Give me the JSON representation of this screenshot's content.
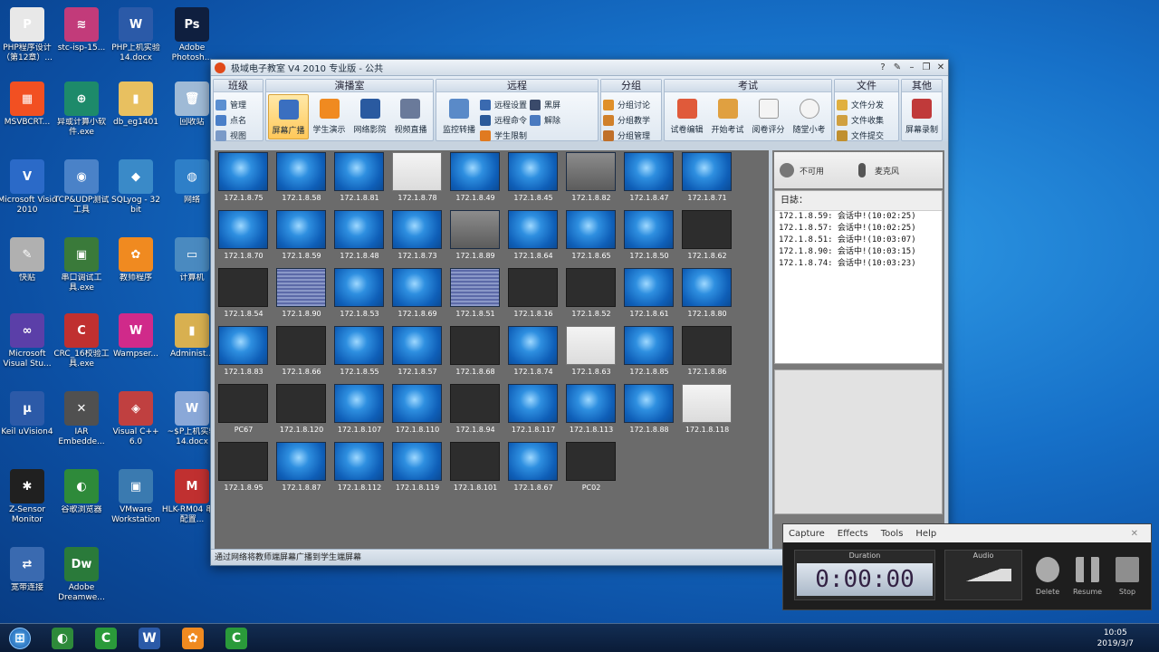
{
  "desktop_icons": [
    {
      "label": "PHP程序设计（第12章）...",
      "color": "#e8e8e8",
      "glyph": "P"
    },
    {
      "label": "stc-isp-15...",
      "color": "#c23b7a",
      "glyph": "≋"
    },
    {
      "label": "PHP上机实验14.docx",
      "color": "#2b5aa8",
      "glyph": "W"
    },
    {
      "label": "Adobe Photosh...",
      "color": "#0f1f3f",
      "glyph": "Ps"
    },
    {
      "label": "MSVBCRT...",
      "color": "#f25022",
      "glyph": "▦"
    },
    {
      "label": "异或计算小软件.exe",
      "color": "#1d8a6a",
      "glyph": "⊕"
    },
    {
      "label": "db_eg1401",
      "color": "#e8c060",
      "glyph": "▮"
    },
    {
      "label": "回收站",
      "color": "#9fbad6",
      "glyph": "🗑"
    },
    {
      "label": "Microsoft Visio 2010",
      "color": "#2b6ac8",
      "glyph": "V"
    },
    {
      "label": "TCP&UDP测试工具",
      "color": "#4a82c8",
      "glyph": "◉"
    },
    {
      "label": "SQLyog - 32 bit",
      "color": "#3a8ac8",
      "glyph": "◆"
    },
    {
      "label": "网络",
      "color": "#2e7fc8",
      "glyph": "◍"
    },
    {
      "label": "快贴",
      "color": "#b0b0b0",
      "glyph": "✎"
    },
    {
      "label": "串口调试工具.exe",
      "color": "#3a7a3a",
      "glyph": "▣"
    },
    {
      "label": "教师程序",
      "color": "#f08a20",
      "glyph": "✿"
    },
    {
      "label": "计算机",
      "color": "#4a8ac0",
      "glyph": "▭"
    },
    {
      "label": "Microsoft Visual Stu...",
      "color": "#5b3fa8",
      "glyph": "∞"
    },
    {
      "label": "CRC_16校验工具.exe",
      "color": "#c03030",
      "glyph": "C"
    },
    {
      "label": "Wampser...",
      "color": "#d02a8a",
      "glyph": "W"
    },
    {
      "label": "Administ...",
      "color": "#d8b050",
      "glyph": "▮"
    },
    {
      "label": "Keil uVision4",
      "color": "#2c5aa8",
      "glyph": "µ"
    },
    {
      "label": "IAR Embedde...",
      "color": "#505050",
      "glyph": "✕"
    },
    {
      "label": "Visual C++ 6.0",
      "color": "#c04040",
      "glyph": "◈"
    },
    {
      "label": "~$P上机实验14.docx",
      "color": "#8aa8d8",
      "glyph": "W"
    },
    {
      "label": "Z-Sensor Monitor",
      "color": "#202020",
      "glyph": "✱"
    },
    {
      "label": "谷歌浏览器",
      "color": "#2e8a3a",
      "glyph": "◐"
    },
    {
      "label": "VMware Workstation",
      "color": "#3a7ab0",
      "glyph": "▣"
    },
    {
      "label": "HLK-RM04 串口配置...",
      "color": "#c03030",
      "glyph": "M"
    },
    {
      "label": "宽带连接",
      "color": "#3a6ab0",
      "glyph": "⇄"
    },
    {
      "label": "Adobe Dreamwe...",
      "color": "#2a7a3a",
      "glyph": "Dw"
    }
  ],
  "window": {
    "title": "极域电子教室 V4 2010 专业版 - 公共",
    "title_buttons": [
      "?",
      "✎",
      "–",
      "❐",
      "✕"
    ]
  },
  "ribbon": {
    "groups": [
      {
        "name": "班级",
        "small": [
          "管理",
          "点名",
          "视图"
        ]
      },
      {
        "name": "演播室",
        "big": [
          "屏幕广播",
          "学生演示",
          "网络影院",
          "视频直播"
        ]
      },
      {
        "name": "远程",
        "big": [
          "监控转播"
        ],
        "small": [
          "远程设置",
          "远程命令",
          "学生限制"
        ],
        "small2": [
          "黑屏",
          "解除"
        ]
      },
      {
        "name": "分组",
        "small": [
          "分组讨论",
          "分组教学",
          "分组管理"
        ]
      },
      {
        "name": "考试",
        "big": [
          "试卷编辑",
          "开始考试",
          "阅卷评分",
          "随堂小考"
        ]
      },
      {
        "name": "文件",
        "small": [
          "文件分发",
          "文件收集",
          "文件提交"
        ]
      },
      {
        "name": "其他",
        "big": [
          "屏幕录制"
        ]
      }
    ]
  },
  "students": [
    {
      "label": "172.1.8.75",
      "state": "on"
    },
    {
      "label": "172.1.8.58",
      "state": "on"
    },
    {
      "label": "172.1.8.81",
      "state": "on"
    },
    {
      "label": "172.1.8.78",
      "state": "white"
    },
    {
      "label": "172.1.8.49",
      "state": "on"
    },
    {
      "label": "172.1.8.45",
      "state": "on"
    },
    {
      "label": "172.1.8.82",
      "state": "dim"
    },
    {
      "label": "172.1.8.47",
      "state": "on"
    },
    {
      "label": "172.1.8.71",
      "state": "on"
    },
    {
      "label": "172.1.8.70",
      "state": "on"
    },
    {
      "label": "172.1.8.59",
      "state": "on"
    },
    {
      "label": "172.1.8.48",
      "state": "on"
    },
    {
      "label": "172.1.8.73",
      "state": "on"
    },
    {
      "label": "172.1.8.89",
      "state": "dim"
    },
    {
      "label": "172.1.8.64",
      "state": "on"
    },
    {
      "label": "172.1.8.65",
      "state": "on"
    },
    {
      "label": "172.1.8.50",
      "state": "on"
    },
    {
      "label": "172.1.8.62",
      "state": "off"
    },
    {
      "label": "172.1.8.54",
      "state": "off"
    },
    {
      "label": "172.1.8.90",
      "state": "grid"
    },
    {
      "label": "172.1.8.53",
      "state": "on"
    },
    {
      "label": "172.1.8.69",
      "state": "on"
    },
    {
      "label": "172.1.8.51",
      "state": "grid"
    },
    {
      "label": "172.1.8.16",
      "state": "off"
    },
    {
      "label": "172.1.8.52",
      "state": "off"
    },
    {
      "label": "172.1.8.61",
      "state": "on"
    },
    {
      "label": "172.1.8.80",
      "state": "on"
    },
    {
      "label": "172.1.8.83",
      "state": "on"
    },
    {
      "label": "172.1.8.66",
      "state": "off"
    },
    {
      "label": "172.1.8.55",
      "state": "on"
    },
    {
      "label": "172.1.8.57",
      "state": "on"
    },
    {
      "label": "172.1.8.68",
      "state": "off"
    },
    {
      "label": "172.1.8.74",
      "state": "on"
    },
    {
      "label": "172.1.8.63",
      "state": "white"
    },
    {
      "label": "172.1.8.85",
      "state": "on"
    },
    {
      "label": "172.1.8.86",
      "state": "off"
    },
    {
      "label": "PC67",
      "state": "off"
    },
    {
      "label": "172.1.8.120",
      "state": "off"
    },
    {
      "label": "172.1.8.107",
      "state": "on"
    },
    {
      "label": "172.1.8.110",
      "state": "on"
    },
    {
      "label": "172.1.8.94",
      "state": "off"
    },
    {
      "label": "172.1.8.117",
      "state": "on"
    },
    {
      "label": "172.1.8.113",
      "state": "on"
    },
    {
      "label": "172.1.8.88",
      "state": "on"
    },
    {
      "label": "172.1.8.118",
      "state": "white"
    },
    {
      "label": "172.1.8.95",
      "state": "off"
    },
    {
      "label": "172.1.8.87",
      "state": "on"
    },
    {
      "label": "172.1.8.112",
      "state": "on"
    },
    {
      "label": "172.1.8.119",
      "state": "on"
    },
    {
      "label": "172.1.8.101",
      "state": "off"
    },
    {
      "label": "172.1.8.67",
      "state": "on"
    },
    {
      "label": "PC02",
      "state": "off"
    }
  ],
  "side_panel": {
    "mic_status": "不可用",
    "mic_label": "麦克风",
    "log_title": "日誌：",
    "log_lines": [
      "172.1.8.59: 会话中!(10:02:25)",
      "172.1.8.57: 会话中!(10:02:25)",
      "172.1.8.51: 会话中!(10:03:07)",
      "172.1.8.90: 会话中!(10:03:15)",
      "172.1.8.74: 会话中!(10:03:23)"
    ]
  },
  "status_bar": "通过网络将教师端屏幕广播到学生端屏幕",
  "recorder": {
    "menu": [
      "Capture",
      "Effects",
      "Tools",
      "Help"
    ],
    "duration_label": "Duration",
    "time": "0:00:00",
    "audio_label": "Audio",
    "controls": [
      "Delete",
      "Resume",
      "Stop"
    ]
  },
  "taskbar": {
    "apps": [
      {
        "name": "chrome",
        "color": "#2e8a3a",
        "glyph": "◐"
      },
      {
        "name": "camtasia",
        "color": "#2a9a3a",
        "glyph": "C"
      },
      {
        "name": "word",
        "color": "#2b5aa8",
        "glyph": "W"
      },
      {
        "name": "teacher",
        "color": "#f08a20",
        "glyph": "✿"
      },
      {
        "name": "camtasia-recorder",
        "color": "#2a9a3a",
        "glyph": "C"
      }
    ],
    "time": "10:05",
    "date": "2019/3/7"
  }
}
